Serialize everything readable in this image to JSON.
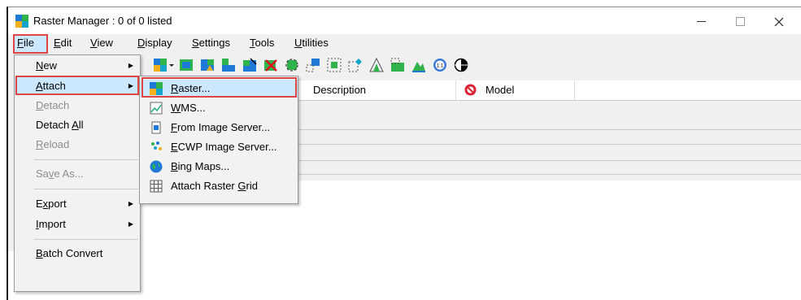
{
  "window": {
    "title": "Raster Manager : 0 of 0 listed"
  },
  "menubar": {
    "items": [
      {
        "pre": "",
        "u": "F",
        "post": "ile"
      },
      {
        "pre": "",
        "u": "E",
        "post": "dit"
      },
      {
        "pre": "",
        "u": "V",
        "post": "iew"
      },
      {
        "pre": "",
        "u": "D",
        "post": "isplay"
      },
      {
        "pre": "",
        "u": "S",
        "post": "ettings"
      },
      {
        "pre": "",
        "u": "T",
        "post": "ools"
      },
      {
        "pre": "",
        "u": "U",
        "post": "tilities"
      }
    ]
  },
  "grid": {
    "columns": [
      "Description",
      "Model"
    ]
  },
  "file_menu": {
    "items": [
      {
        "pre": "",
        "u": "N",
        "post": "ew",
        "disabled": false,
        "submenu": true
      },
      {
        "pre": "",
        "u": "A",
        "post": "ttach",
        "disabled": false,
        "submenu": true
      },
      {
        "pre": "",
        "u": "D",
        "post": "etach",
        "disabled": true,
        "submenu": false
      },
      {
        "pre": "Detach ",
        "u": "A",
        "post": "ll",
        "disabled": false,
        "submenu": false
      },
      {
        "pre": "",
        "u": "R",
        "post": "eload",
        "disabled": true,
        "submenu": false
      },
      {
        "pre": "Sa",
        "u": "v",
        "post": "e As...",
        "disabled": true,
        "submenu": false
      },
      {
        "pre": "E",
        "u": "x",
        "post": "port",
        "disabled": false,
        "submenu": true
      },
      {
        "pre": "",
        "u": "I",
        "post": "mport",
        "disabled": false,
        "submenu": true
      },
      {
        "pre": "",
        "u": "B",
        "post": "atch Convert",
        "disabled": false,
        "submenu": false
      }
    ]
  },
  "attach_submenu": {
    "items": [
      {
        "pre": "",
        "u": "R",
        "post": "aster...",
        "icon": "raster-icon"
      },
      {
        "pre": "",
        "u": "W",
        "post": "MS...",
        "icon": "wms-icon"
      },
      {
        "pre": "",
        "u": "F",
        "post": "rom Image Server...",
        "icon": "image-server-icon"
      },
      {
        "pre": "",
        "u": "E",
        "post": "CWP Image Server...",
        "icon": "ecwp-icon"
      },
      {
        "pre": "",
        "u": "B",
        "post": "ing Maps...",
        "icon": "globe-icon"
      },
      {
        "pre": "Attach Raster ",
        "u": "G",
        "post": "rid",
        "icon": "grid-icon"
      }
    ]
  },
  "colors": {
    "highlight": "#cce8ff",
    "callout": "#e04545"
  }
}
